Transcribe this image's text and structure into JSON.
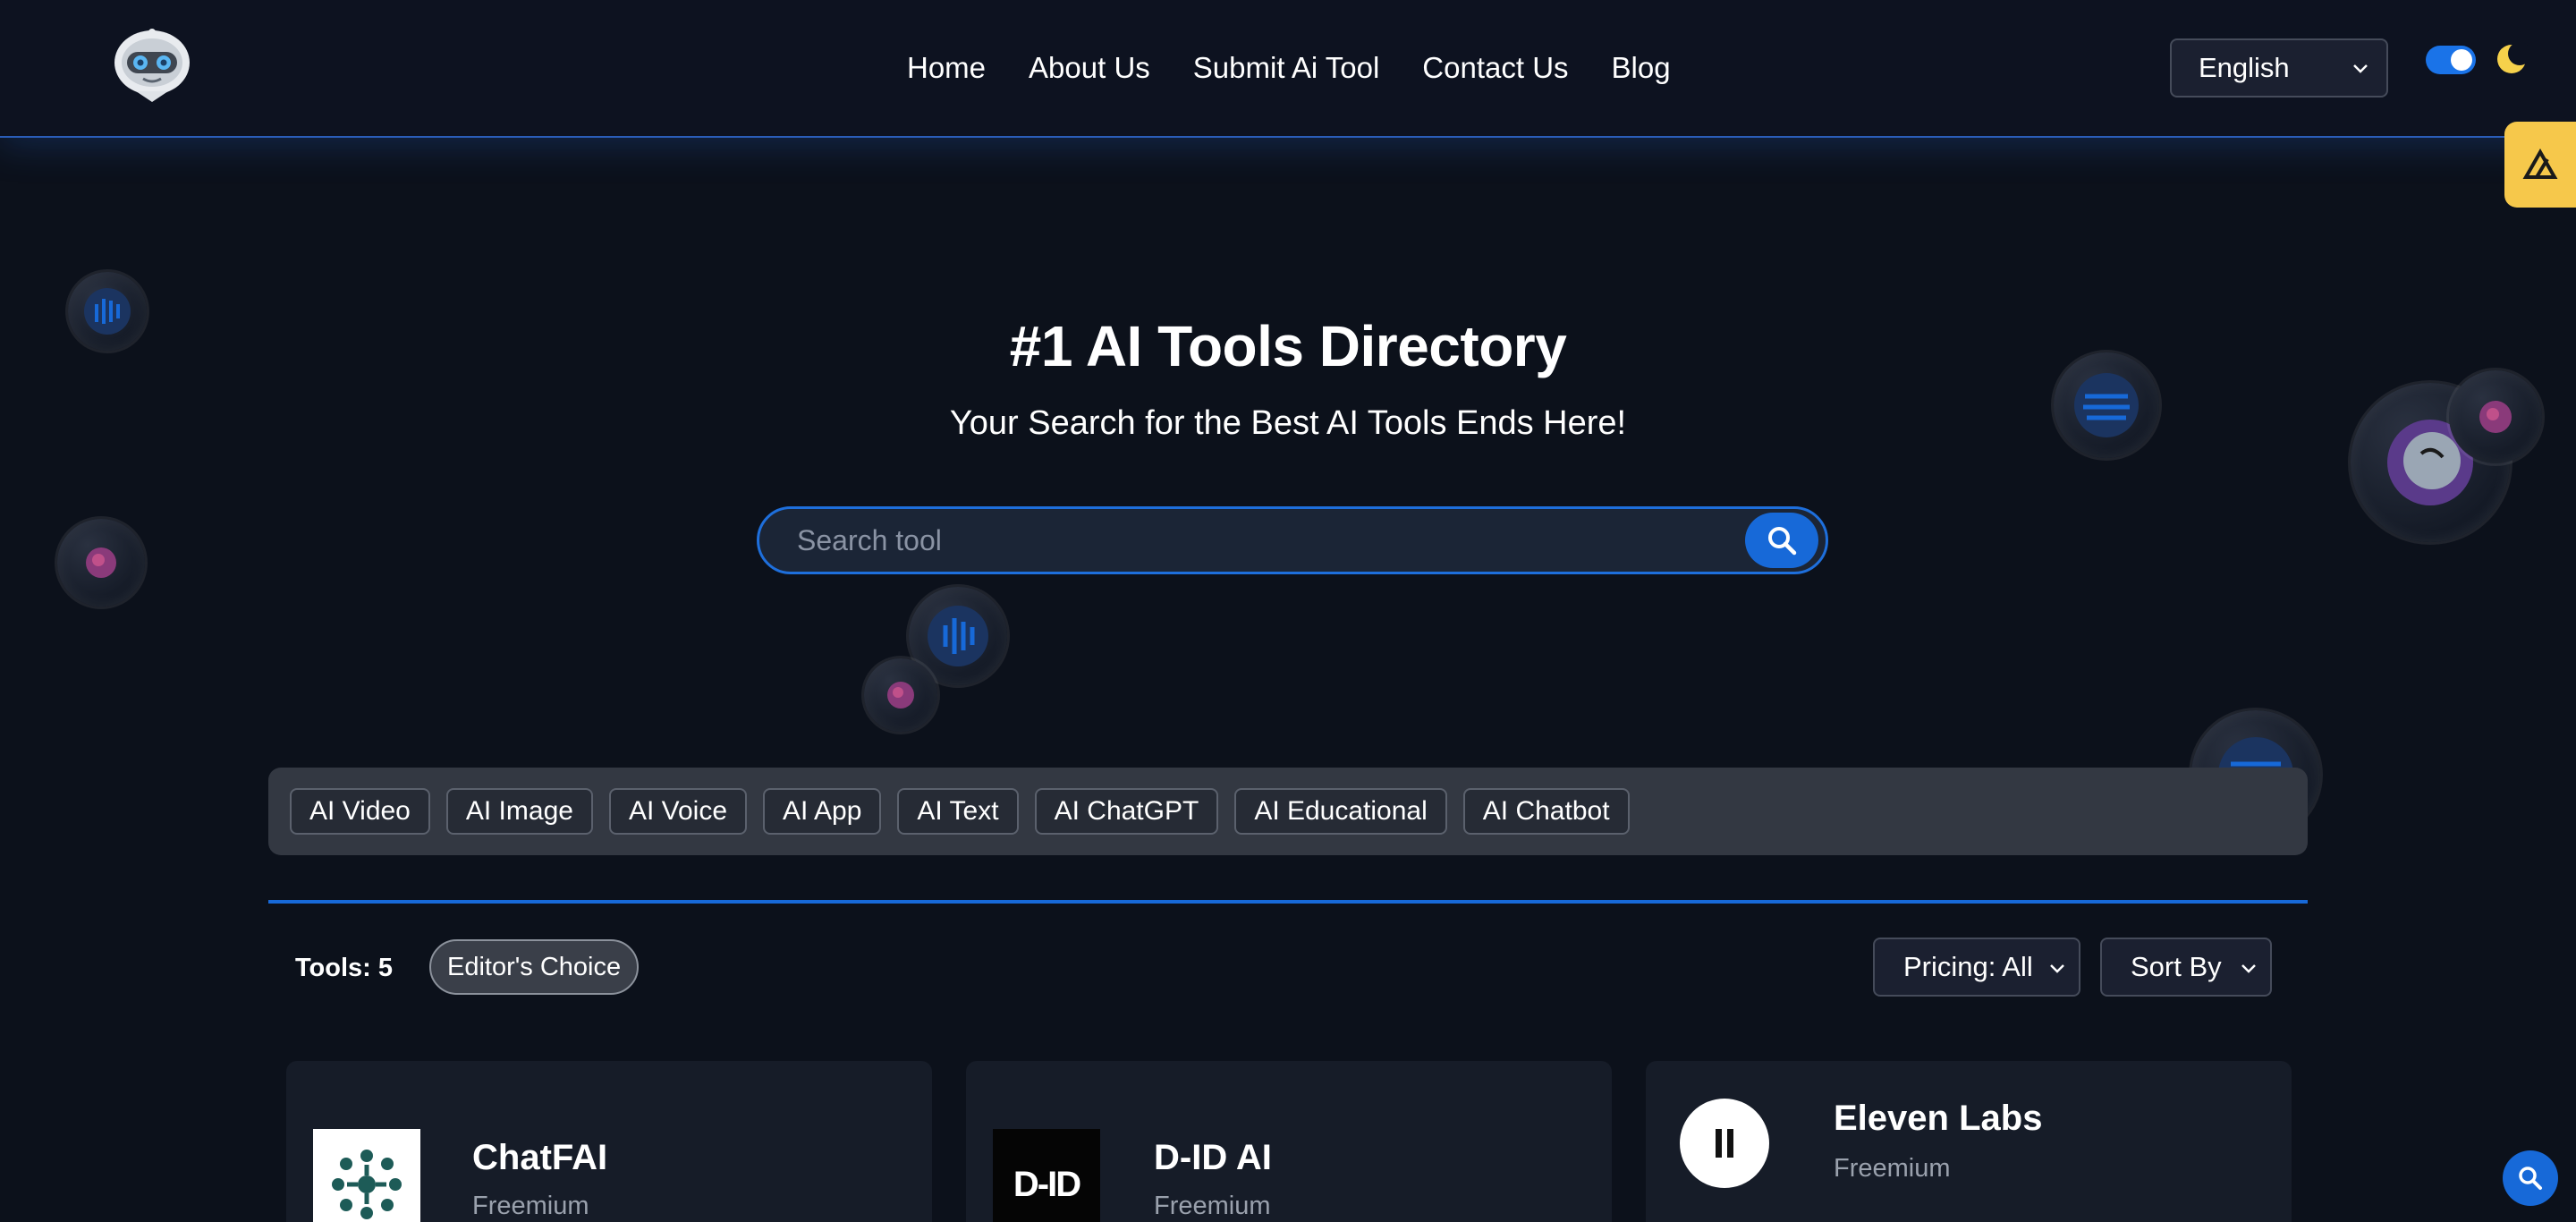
{
  "header": {
    "nav": [
      "Home",
      "About Us",
      "Submit Ai Tool",
      "Contact Us",
      "Blog"
    ],
    "language": "English",
    "dark_mode": true
  },
  "hero": {
    "title": "#1 AI Tools Directory",
    "subtitle": "Your Search for the Best AI Tools Ends Here!",
    "search_placeholder": "Search tool"
  },
  "categories": [
    "AI Video",
    "AI Image",
    "AI Voice",
    "AI App",
    "AI Text",
    "AI ChatGPT",
    "AI Educational",
    "AI Chatbot"
  ],
  "toolbar": {
    "tools_count": "Tools: 5",
    "editors_choice": "Editor's Choice",
    "pricing": "Pricing: All",
    "sort": "Sort By"
  },
  "cards": [
    {
      "name": "ChatFAI",
      "pricing": "Freemium",
      "logo_icon": "chatfai-logo-icon"
    },
    {
      "name": "D-ID AI",
      "pricing": "Freemium",
      "logo_icon": "d-id-logo-icon",
      "logo_text": "D-ID"
    },
    {
      "name": "Eleven Labs",
      "pricing": "Freemium",
      "logo_icon": "elevenlabs-logo-icon"
    }
  ],
  "colors": {
    "background": "#0c111b",
    "accent": "#1769d8",
    "badge": "#f6c84b",
    "chatfai_green": "#1d5b57"
  }
}
